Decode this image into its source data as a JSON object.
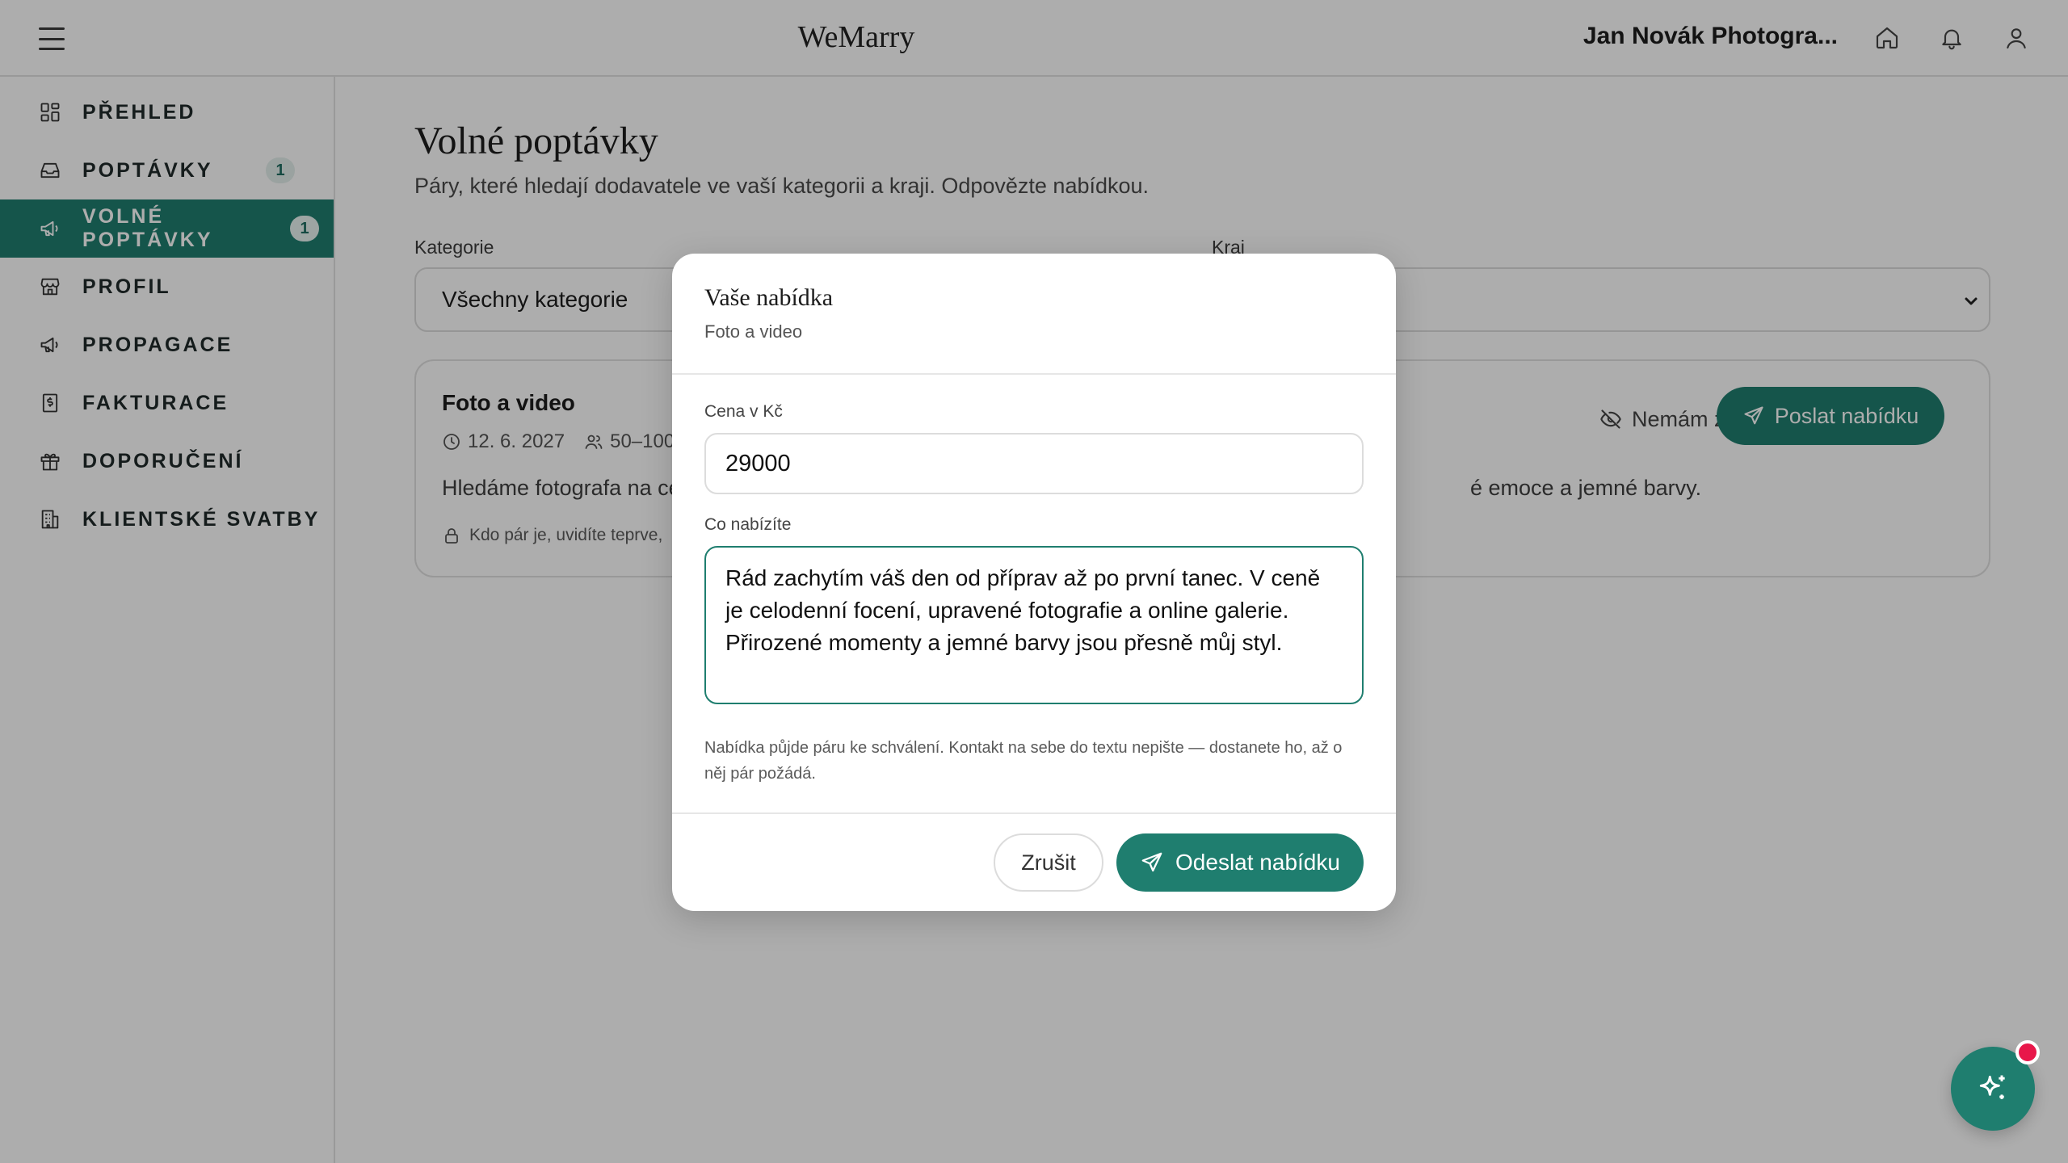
{
  "header": {
    "brand": "WeMarry",
    "vendor_name": "Jan Novák Photogra..."
  },
  "sidebar": {
    "items": [
      {
        "label": "PŘEHLED",
        "icon": "dashboard-icon"
      },
      {
        "label": "POPTÁVKY",
        "icon": "inbox-icon",
        "badge": "1"
      },
      {
        "label": "VOLNÉ POPTÁVKY",
        "icon": "megaphone-icon",
        "badge": "1",
        "active": true
      },
      {
        "label": "PROFIL",
        "icon": "store-icon"
      },
      {
        "label": "PROPAGACE",
        "icon": "megaphone-icon"
      },
      {
        "label": "FAKTURACE",
        "icon": "invoice-icon"
      },
      {
        "label": "DOPORUČENÍ",
        "icon": "gift-icon"
      },
      {
        "label": "KLIENTSKÉ SVATBY",
        "icon": "building-icon"
      }
    ]
  },
  "main": {
    "title": "Volné poptávky",
    "subtitle": "Páry, které hledají dodavatele ve vaší kategorii a kraji. Odpovězte nabídkou.",
    "filters": {
      "category_label": "Kategorie",
      "category_value": "Všechny kategorie",
      "region_label": "Kraj",
      "region_value": ""
    },
    "card": {
      "title": "Foto a video",
      "date": "12. 6. 2027",
      "guests": "50–100",
      "description_start": "Hledáme fotografa na ce",
      "description_end": "é emoce a jemné barvy.",
      "privacy_note": "Kdo pár je, uvidíte teprve,",
      "not_interested_label": "Nemám zájem",
      "send_offer_label": "Poslat nabídku"
    }
  },
  "modal": {
    "title": "Vaše nabídka",
    "subtitle": "Foto a video",
    "price_label": "Cena v Kč",
    "price_value": "29000",
    "offer_label": "Co nabízíte",
    "offer_value": "Rád zachytím váš den od příprav až po první tanec. V ceně je celodenní focení, upravené fotografie a online galerie. Přirozené momenty a jemné barvy jsou přesně můj styl.",
    "hint": "Nabídka půjde páru ke schválení. Kontakt na sebe do textu nepište — dostanete ho, až o něj pár požádá.",
    "cancel_label": "Zrušit",
    "submit_label": "Odeslat nabídku"
  },
  "colors": {
    "accent": "#1f7e6f",
    "notification_dot": "#e8174a"
  }
}
